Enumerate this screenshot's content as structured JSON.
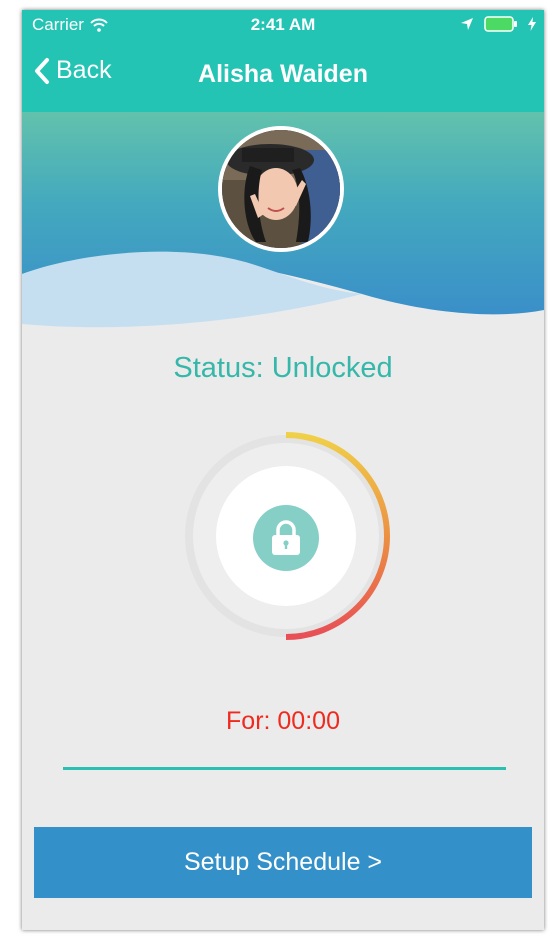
{
  "status_bar": {
    "carrier": "Carrier",
    "time": "2:41 AM",
    "icons": [
      "wifi-icon",
      "location-arrow-icon",
      "battery-icon",
      "charging-bolt-icon"
    ]
  },
  "nav": {
    "back_label": "Back",
    "title": "Alisha Waiden"
  },
  "profile": {
    "avatar_icon": "user-photo-avatar"
  },
  "lock": {
    "status_text": "Status: Unlocked",
    "icon": "lock-icon",
    "progress_fraction": 0.5,
    "timer_text": "For: 00:00"
  },
  "actions": {
    "setup_schedule_label": "Setup Schedule >"
  },
  "colors": {
    "accent": "#24c4b4",
    "status_text": "#35b7aa",
    "timer_text": "#f02a1f",
    "button": "#3490c8",
    "ring_start": "#f0d048",
    "ring_end": "#e84f57"
  }
}
